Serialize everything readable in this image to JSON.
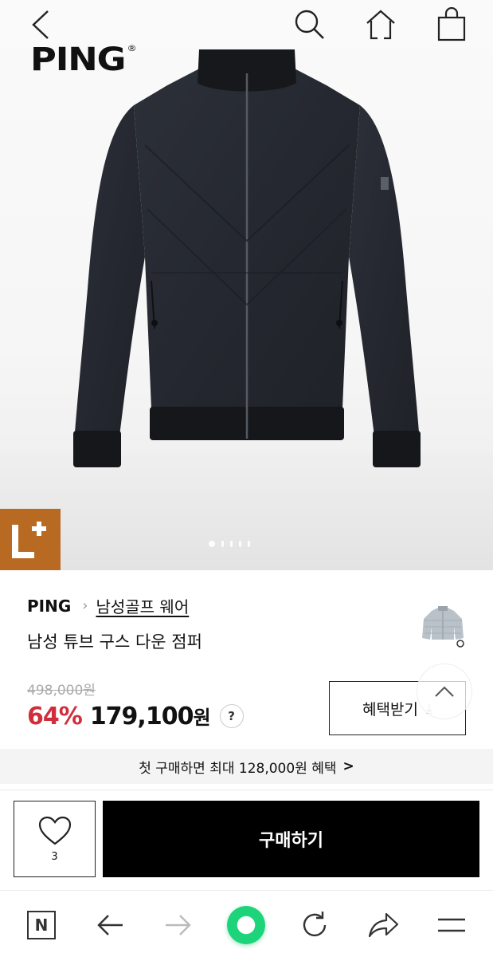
{
  "header": {
    "brand_logo": "PING",
    "logo_mark": "®",
    "icons": [
      "back-chevron-icon",
      "search-icon",
      "home-icon",
      "shopping-bag-icon"
    ]
  },
  "hero": {
    "badge_text": "L",
    "badge_plus": "+",
    "badge_color": "#b96a22",
    "slide_count": 5,
    "active_slide": 1
  },
  "product": {
    "brand": "PING",
    "category": "남성골프 웨어",
    "name": "남성 튜브 구스 다운 점퍼",
    "original_price": "498,000원",
    "discount": "64%",
    "sale_price": "179,100",
    "currency": "원",
    "help_label": "?",
    "benefit_button": "혜택받기"
  },
  "promo": {
    "text": "첫 구매하면 최대 128,000원 혜택",
    "chevron": ">"
  },
  "actions": {
    "wish_count": "3",
    "buy_label": "구매하기"
  },
  "browser": {
    "home_letter": "N",
    "icons": [
      "naver-n-icon",
      "back-arrow-icon",
      "forward-arrow-icon",
      "green-dot-icon",
      "refresh-icon",
      "share-icon",
      "menu-icon"
    ],
    "accent": "#1ed47a"
  },
  "colors": {
    "discount": "#d12d3a",
    "primary": "#000000"
  }
}
